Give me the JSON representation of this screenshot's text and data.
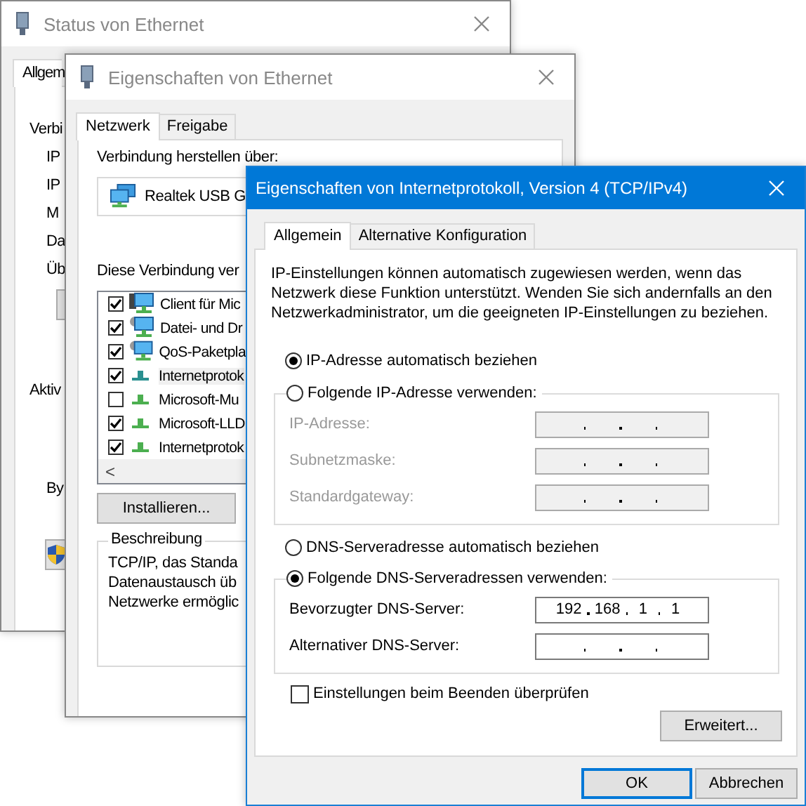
{
  "status_window": {
    "title": "Status von Ethernet",
    "tab": "Allgem",
    "connection_heading": "Verbi",
    "connection_rows": [
      "IP",
      "IP",
      "M",
      "Da",
      "Üb"
    ],
    "activity_heading": "Aktiv",
    "activity_rows": [
      "By"
    ]
  },
  "properties_window": {
    "title": "Eigenschaften von Ethernet",
    "tabs": [
      {
        "label": "Netzwerk",
        "selected": true
      },
      {
        "label": "Freigabe",
        "selected": false
      }
    ],
    "connect_label": "Verbindung herstellen über:",
    "adapter": "Realtek USB G",
    "uses_label": "Diese Verbindung ver",
    "items": [
      {
        "label": "Client für Mic",
        "kind": "client",
        "checked": true,
        "selected": false
      },
      {
        "label": "Datei- und Dr",
        "kind": "service",
        "checked": true,
        "selected": false
      },
      {
        "label": "QoS-Paketpla",
        "kind": "service",
        "checked": true,
        "selected": false
      },
      {
        "label": "Internetprotok",
        "kind": "protocol",
        "checked": true,
        "selected": true
      },
      {
        "label": "Microsoft-Mu",
        "kind": "protocol",
        "checked": false,
        "selected": false
      },
      {
        "label": "Microsoft-LLD",
        "kind": "protocol",
        "checked": true,
        "selected": false
      },
      {
        "label": "Internetprotok",
        "kind": "protocol",
        "checked": true,
        "selected": false
      }
    ],
    "scroll_arrow": "<",
    "install_button": "Installieren...",
    "description_title": "Beschreibung",
    "description_lines": [
      "TCP/IP, das Standa",
      "Datenaustausch üb",
      "Netzwerke ermöglic"
    ]
  },
  "ipv4_window": {
    "title": "Eigenschaften von Internetprotokoll, Version 4 (TCP/IPv4)",
    "tabs": [
      {
        "label": "Allgemein",
        "selected": true
      },
      {
        "label": "Alternative Konfiguration",
        "selected": false
      }
    ],
    "intro": "IP-Einstellungen können automatisch zugewiesen werden, wenn das Netzwerk diese Funktion unterstützt. Wenden Sie sich andernfalls an den Netzwerkadministrator, um die geeigneten IP-Einstellungen zu beziehen.",
    "ip_auto": {
      "label": "IP-Adresse automatisch beziehen",
      "selected": true
    },
    "ip_manual": {
      "label": "Folgende IP-Adresse verwenden:",
      "selected": false
    },
    "ip_fields": [
      {
        "label": "IP-Adresse:",
        "disabled": true
      },
      {
        "label": "Subnetzmaske:",
        "disabled": true
      },
      {
        "label": "Standardgateway:",
        "disabled": true
      }
    ],
    "dns_auto": {
      "label": "DNS-Serveradresse automatisch beziehen",
      "selected": false
    },
    "dns_manual": {
      "label": "Folgende DNS-Serveradressen verwenden:",
      "selected": true
    },
    "dns_fields": [
      {
        "label": "Bevorzugter DNS-Server:",
        "disabled": false,
        "octets": [
          "192",
          "168",
          "1",
          "1"
        ]
      },
      {
        "label": "Alternativer DNS-Server:",
        "disabled": false
      }
    ],
    "validate": {
      "label": "Einstellungen beim Beenden überprüfen",
      "checked": false
    },
    "advanced_button": "Erweitert...",
    "ok_button": "OK",
    "cancel_button": "Abbrechen"
  }
}
